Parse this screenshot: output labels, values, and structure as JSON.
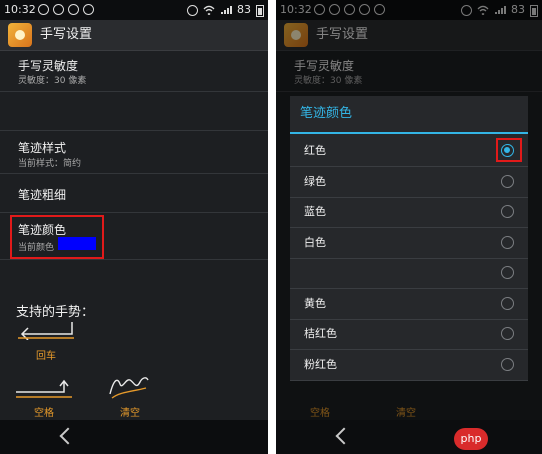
{
  "status_bar": {
    "time": "10:32",
    "battery": "83"
  },
  "app": {
    "title": "手写设置"
  },
  "settings": {
    "sensitivity": {
      "title": "手写灵敏度",
      "summary": "灵敏度：30 像素"
    },
    "stroke_style": {
      "title": "笔迹样式",
      "summary": "当前样式：简约"
    },
    "stroke_width": {
      "title": "笔迹粗细"
    },
    "stroke_color": {
      "title": "笔迹颜色",
      "summary": "当前颜色",
      "current_color": "#0000ff"
    }
  },
  "gestures": {
    "heading": "支持的手势：",
    "items": [
      {
        "label": "回车",
        "icon": "enter-gesture-icon"
      },
      {
        "label": "空格",
        "icon": "space-gesture-icon"
      },
      {
        "label": "清空",
        "icon": "clear-gesture-icon"
      }
    ]
  },
  "color_dialog": {
    "title": "笔迹颜色",
    "options": [
      {
        "label": "红色",
        "selected": true
      },
      {
        "label": "绿色",
        "selected": false
      },
      {
        "label": "蓝色",
        "selected": false
      },
      {
        "label": "白色",
        "selected": false
      },
      {
        "label": "",
        "selected": false
      },
      {
        "label": "黄色",
        "selected": false
      },
      {
        "label": "桔红色",
        "selected": false
      },
      {
        "label": "粉红色",
        "selected": false
      }
    ]
  },
  "background_gestures": {
    "space": "空格",
    "clear": "清空"
  },
  "watermark": "php",
  "colors": {
    "accent": "#33b5e5",
    "highlight": "#e11a1a",
    "gesture": "#e69a2b"
  }
}
